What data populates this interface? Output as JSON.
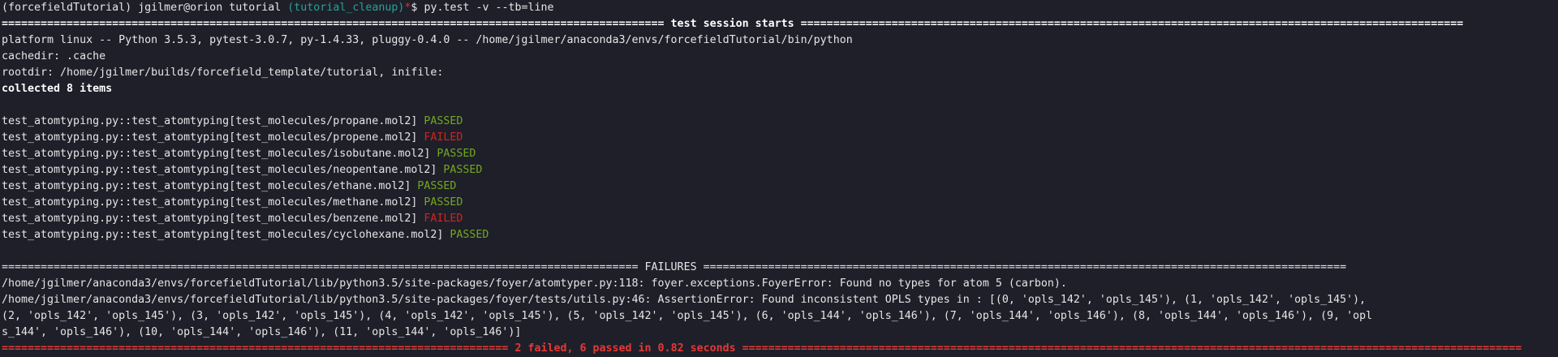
{
  "prompt": {
    "env": "(forcefieldTutorial)",
    "user_host": "jgilmer@orion",
    "cwd": "tutorial",
    "branch": "(tutorial_cleanup)",
    "dirty_marker": "*",
    "symbol": "$",
    "command": "py.test -v --tb=line"
  },
  "session_header": "====================================================================================================== test session starts ======================================================================================================",
  "platform_line": "platform linux -- Python 3.5.3, pytest-3.0.7, py-1.4.33, pluggy-0.4.0 -- /home/jgilmer/anaconda3/envs/forcefieldTutorial/bin/python",
  "cachedir_line": "cachedir: .cache",
  "rootdir_line": "rootdir: /home/jgilmer/builds/forcefield_template/tutorial, inifile:",
  "collected_line": "collected 8 items",
  "tests": [
    {
      "name": "test_atomtyping.py::test_atomtyping[test_molecules/propane.mol2]",
      "status": "PASSED"
    },
    {
      "name": "test_atomtyping.py::test_atomtyping[test_molecules/propene.mol2]",
      "status": "FAILED"
    },
    {
      "name": "test_atomtyping.py::test_atomtyping[test_molecules/isobutane.mol2]",
      "status": "PASSED"
    },
    {
      "name": "test_atomtyping.py::test_atomtyping[test_molecules/neopentane.mol2]",
      "status": "PASSED"
    },
    {
      "name": "test_atomtyping.py::test_atomtyping[test_molecules/ethane.mol2]",
      "status": "PASSED"
    },
    {
      "name": "test_atomtyping.py::test_atomtyping[test_molecules/methane.mol2]",
      "status": "PASSED"
    },
    {
      "name": "test_atomtyping.py::test_atomtyping[test_molecules/benzene.mol2]",
      "status": "FAILED"
    },
    {
      "name": "test_atomtyping.py::test_atomtyping[test_molecules/cyclohexane.mol2]",
      "status": "PASSED"
    }
  ],
  "failures_header": "================================================================================================== FAILURES ===================================================================================================",
  "failure_lines": [
    "/home/jgilmer/anaconda3/envs/forcefieldTutorial/lib/python3.5/site-packages/foyer/atomtyper.py:118: foyer.exceptions.FoyerError: Found no types for atom 5 (carbon).",
    "/home/jgilmer/anaconda3/envs/forcefieldTutorial/lib/python3.5/site-packages/foyer/tests/utils.py:46: AssertionError: Found inconsistent OPLS types in : [(0, 'opls_142', 'opls_145'), (1, 'opls_142', 'opls_145'),",
    "(2, 'opls_142', 'opls_145'), (3, 'opls_142', 'opls_145'), (4, 'opls_142', 'opls_145'), (5, 'opls_142', 'opls_145'), (6, 'opls_144', 'opls_146'), (7, 'opls_144', 'opls_146'), (8, 'opls_144', 'opls_146'), (9, 'opl",
    "s_144', 'opls_146'), (10, 'opls_144', 'opls_146'), (11, 'opls_144', 'opls_146')]"
  ],
  "summary": {
    "left_rule": "==============================================================================",
    "text": "2 failed, 6 passed in 0.82 seconds",
    "right_rule": "========================================================================================================================"
  },
  "colors": {
    "background": "#1e1f29",
    "foreground": "#e6e6e6",
    "passed": "#73a81f",
    "failed": "#d6231e",
    "branch": "#2aa198",
    "summary": "#e53935"
  }
}
